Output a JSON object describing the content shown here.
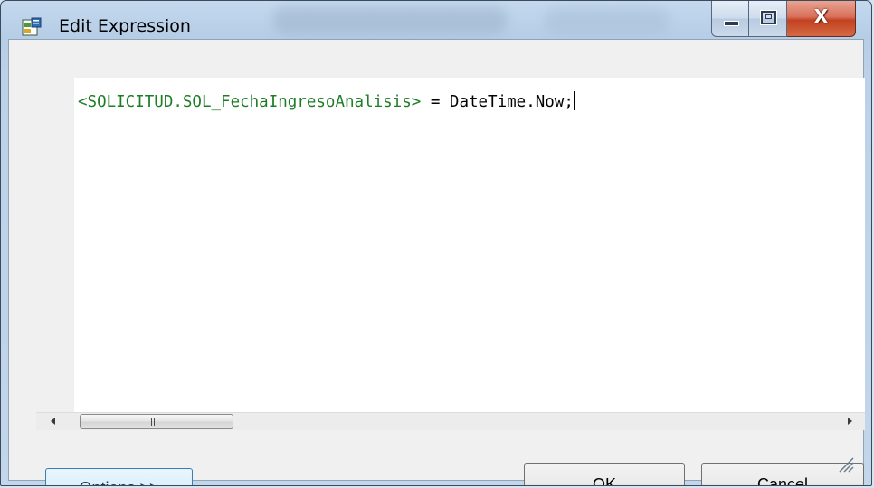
{
  "window": {
    "title": "Edit Expression",
    "icon": "app-expression-icon",
    "controls": {
      "minimize_icon": "minimize-icon",
      "maximize_icon": "maximize-icon",
      "close_label": "X"
    }
  },
  "editor": {
    "lines": [
      {
        "field_token": "<SOLICITUD.SOL_FechaIngresoAnalisis>",
        "rest": " = DateTime.Now;"
      }
    ],
    "field_color": "#1d7d26"
  },
  "scrollbar": {
    "grip_label": "III"
  },
  "buttons": {
    "options": "Options >>",
    "ok": "OK",
    "cancel": "Cancel"
  },
  "colors": {
    "accent_button_border": "#3c7fb1",
    "close_button": "#c3411f"
  }
}
